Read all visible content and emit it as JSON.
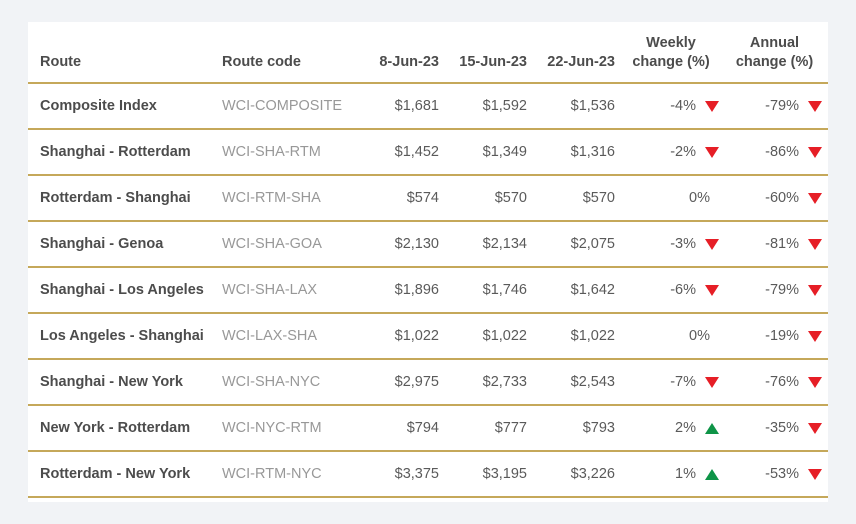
{
  "table": {
    "columns": [
      {
        "key": "route",
        "label": "Route",
        "align": "left"
      },
      {
        "key": "code",
        "label": "Route code",
        "align": "left"
      },
      {
        "key": "d1",
        "label": "8-Jun-23",
        "align": "right"
      },
      {
        "key": "d2",
        "label": "15-Jun-23",
        "align": "right"
      },
      {
        "key": "d3",
        "label": "22-Jun-23",
        "align": "right"
      },
      {
        "key": "weekly",
        "label_line1": "Weekly",
        "label_line2": "change (%)",
        "align": "center"
      },
      {
        "key": "annual",
        "label_line1": "Annual",
        "label_line2": "change (%)",
        "align": "center"
      }
    ],
    "rows": [
      {
        "route": "Composite Index",
        "code": "WCI-COMPOSITE",
        "d1": "$1,681",
        "d2": "$1,592",
        "d3": "$1,536",
        "weekly": {
          "value": "-4%",
          "direction": "down"
        },
        "annual": {
          "value": "-79%",
          "direction": "down"
        }
      },
      {
        "route": "Shanghai - Rotterdam",
        "code": "WCI-SHA-RTM",
        "d1": "$1,452",
        "d2": "$1,349",
        "d3": "$1,316",
        "weekly": {
          "value": "-2%",
          "direction": "down"
        },
        "annual": {
          "value": "-86%",
          "direction": "down"
        }
      },
      {
        "route": "Rotterdam - Shanghai",
        "code": "WCI-RTM-SHA",
        "d1": "$574",
        "d2": "$570",
        "d3": "$570",
        "weekly": {
          "value": "0%",
          "direction": "none"
        },
        "annual": {
          "value": "-60%",
          "direction": "down"
        }
      },
      {
        "route": "Shanghai - Genoa",
        "code": "WCI-SHA-GOA",
        "d1": "$2,130",
        "d2": "$2,134",
        "d3": "$2,075",
        "weekly": {
          "value": "-3%",
          "direction": "down"
        },
        "annual": {
          "value": "-81%",
          "direction": "down"
        }
      },
      {
        "route": "Shanghai - Los Angeles",
        "code": "WCI-SHA-LAX",
        "d1": "$1,896",
        "d2": "$1,746",
        "d3": "$1,642",
        "weekly": {
          "value": "-6%",
          "direction": "down"
        },
        "annual": {
          "value": "-79%",
          "direction": "down"
        }
      },
      {
        "route": "Los Angeles - Shanghai",
        "code": "WCI-LAX-SHA",
        "d1": "$1,022",
        "d2": "$1,022",
        "d3": "$1,022",
        "weekly": {
          "value": "0%",
          "direction": "none"
        },
        "annual": {
          "value": "-19%",
          "direction": "down"
        }
      },
      {
        "route": "Shanghai - New York",
        "code": "WCI-SHA-NYC",
        "d1": "$2,975",
        "d2": "$2,733",
        "d3": "$2,543",
        "weekly": {
          "value": "-7%",
          "direction": "down"
        },
        "annual": {
          "value": "-76%",
          "direction": "down"
        }
      },
      {
        "route": "New York - Rotterdam",
        "code": "WCI-NYC-RTM",
        "d1": "$794",
        "d2": "$777",
        "d3": "$793",
        "weekly": {
          "value": "2%",
          "direction": "up"
        },
        "annual": {
          "value": "-35%",
          "direction": "down"
        }
      },
      {
        "route": "Rotterdam - New York",
        "code": "WCI-RTM-NYC",
        "d1": "$3,375",
        "d2": "$3,195",
        "d3": "$3,226",
        "weekly": {
          "value": "1%",
          "direction": "up"
        },
        "annual": {
          "value": "-53%",
          "direction": "down"
        }
      }
    ]
  },
  "colors": {
    "page_background": "#f1f3f6",
    "card_background": "#ffffff",
    "rule": "#c5a85a",
    "header_text": "#4c4c4c",
    "body_text": "#5a5a5a",
    "code_text": "#989898",
    "down_arrow": "#e61e26",
    "up_arrow": "#0e9447"
  }
}
